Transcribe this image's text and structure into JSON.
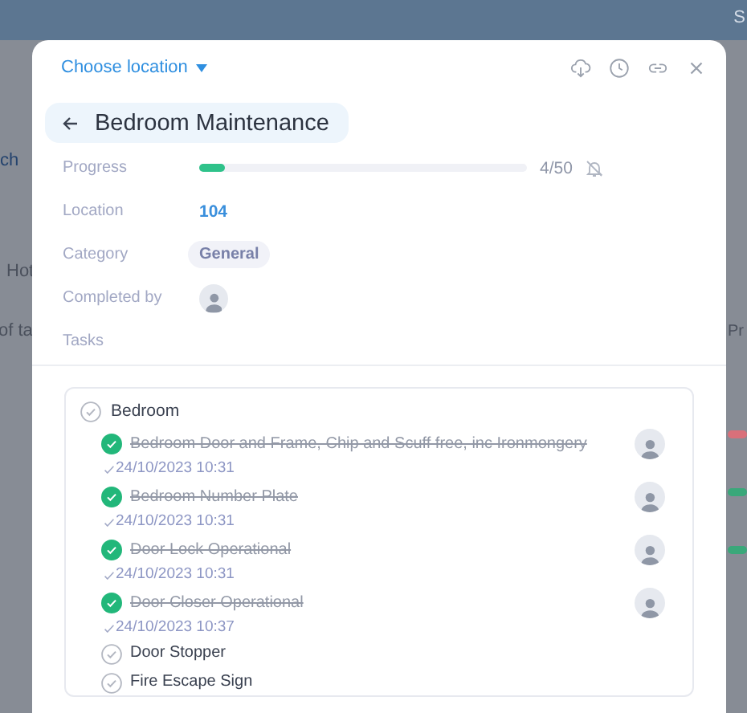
{
  "backdrop": {
    "fragments": [
      {
        "text": "S",
        "kind": "corner"
      },
      {
        "text": "ch",
        "kind": "link"
      },
      {
        "text": "Hot",
        "kind": "plain"
      },
      {
        "text": "of ta",
        "kind": "plain"
      },
      {
        "text": "Pr",
        "kind": "right"
      }
    ],
    "markers": [
      {
        "color": "#d9707a"
      },
      {
        "color": "#3aa87a"
      },
      {
        "color": "#3aa87a"
      }
    ]
  },
  "modal": {
    "location_picker": "Choose location",
    "title": "Bedroom Maintenance",
    "details": [
      {
        "kind": "progress",
        "label": "Progress",
        "level": 0.08,
        "reading": "4/50",
        "notifications_muted": true
      },
      {
        "kind": "link",
        "label": "Location",
        "value": "104"
      },
      {
        "kind": "tag",
        "label": "Category",
        "value": "General"
      },
      {
        "kind": "avatar",
        "label": "Completed by"
      },
      {
        "kind": "heading",
        "label": "Tasks"
      }
    ],
    "task_group": {
      "name": "Bedroom",
      "checked": false,
      "tasks": [
        {
          "name": "Bedroom Door and Frame, Chip and Scuff free, inc Ironmongery",
          "checked": true,
          "completed_at": "24/10/2023 10:31"
        },
        {
          "name": "Bedroom Number Plate",
          "checked": true,
          "completed_at": "24/10/2023 10:31"
        },
        {
          "name": "Door Lock Operational",
          "checked": true,
          "completed_at": "24/10/2023 10:31"
        },
        {
          "name": "Door Closer Operational",
          "checked": true,
          "completed_at": "24/10/2023 10:37"
        },
        {
          "name": "Door Stopper",
          "checked": false
        },
        {
          "name": "Fire Escape Sign",
          "checked": false
        }
      ]
    }
  }
}
